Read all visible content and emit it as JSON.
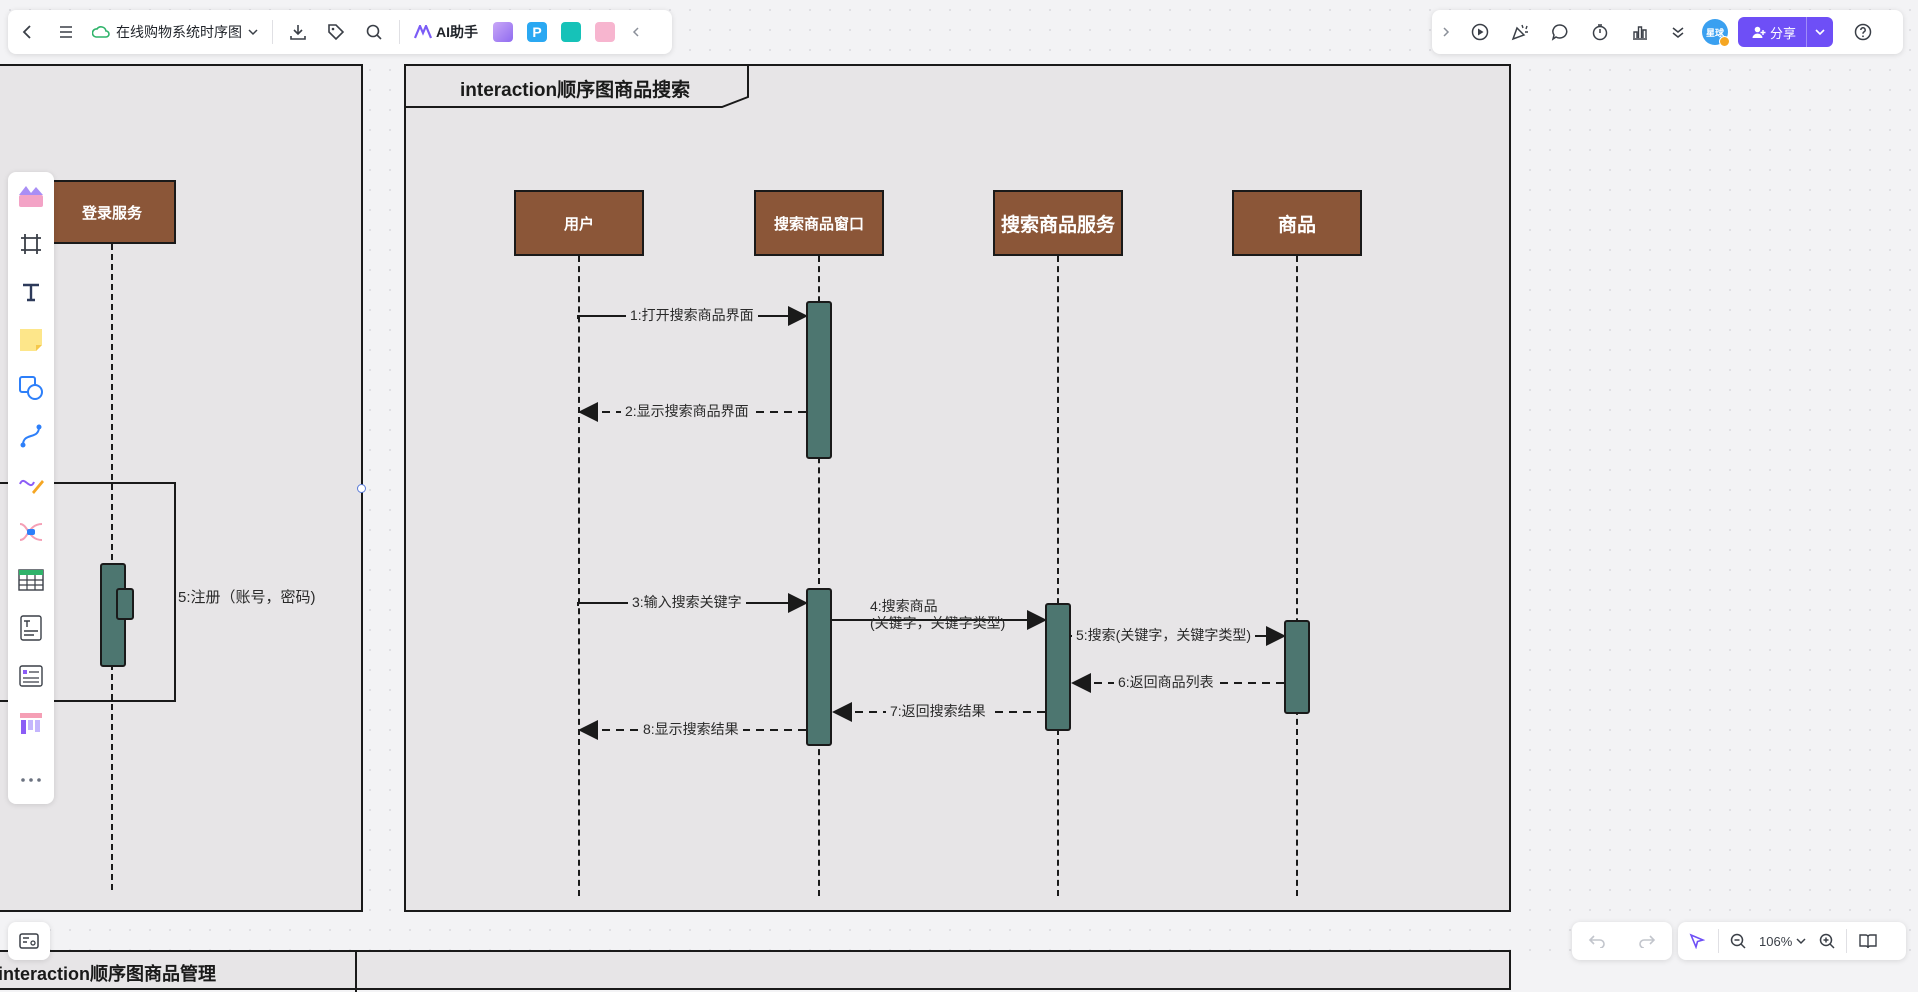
{
  "toolbar": {
    "doc_title": "在线购物系统时序图",
    "ai_label": "AI助手",
    "share_label": "分享",
    "avatar_text": "星球"
  },
  "left_frame": {
    "lifeline": "登录服务",
    "message": "5:注册（账号，密码)"
  },
  "main_frame": {
    "title": "interaction顺序图商品搜索",
    "lifelines": [
      "用户",
      "搜索商品窗口",
      "搜索商品服务",
      "商品"
    ],
    "messages": {
      "m1": "1:打开搜索商品界面",
      "m2": "2:显示搜索商品界面",
      "m3": "3:输入搜索关键字",
      "m4_line1": "4:搜索商品",
      "m4_line2": "(关键字，关键字类型)",
      "m5": "5:搜索(关键字，关键字类型)",
      "m6": "6:返回商品列表",
      "m7": "7:返回搜索结果",
      "m8": "8:显示搜索结果"
    }
  },
  "bottom_frame": {
    "title": "interaction顺序图商品管理"
  },
  "zoom": {
    "level": "106%"
  },
  "colors": {
    "lifeline_box": "#8b5638",
    "activation": "#4d7670",
    "frame_bg": "#e7e5e7",
    "share_accent": "#6e4ff6"
  }
}
